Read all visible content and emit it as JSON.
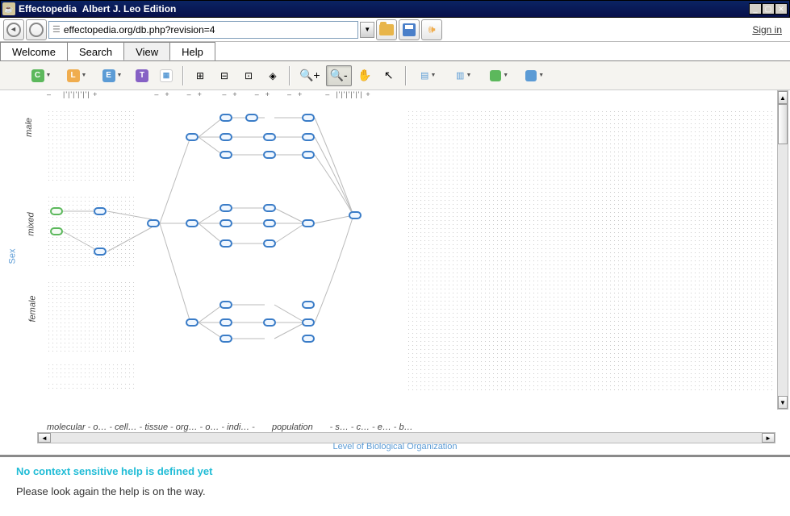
{
  "titlebar": {
    "app_name": "Effectopedia",
    "edition": "Albert J. Leo Edition"
  },
  "url": "effectopedia.org/db.php?revision=4",
  "signin_label": "Sign in",
  "tabs": [
    {
      "label": "Welcome",
      "key": "welcome"
    },
    {
      "label": "Search",
      "key": "search"
    },
    {
      "label": "View",
      "key": "view",
      "active": true
    },
    {
      "label": "Help",
      "key": "help"
    }
  ],
  "toolbar_icons": [
    {
      "name": "chemical-icon",
      "letter": "C",
      "color": "#5cb85c",
      "dd": true
    },
    {
      "name": "link-icon",
      "letter": "L",
      "color": "#f0ad4e",
      "dd": true
    },
    {
      "name": "effect-icon",
      "letter": "E",
      "color": "#5b9bd5",
      "dd": true
    },
    {
      "name": "test-icon",
      "letter": "T",
      "color": "#8661c5"
    },
    {
      "name": "grid-icon",
      "letter": "▦",
      "color": "#d9534f"
    }
  ],
  "axes": {
    "y_label": "Sex",
    "y_ticks": [
      "male",
      "mixed",
      "female"
    ],
    "x_label": "Level of Biological Organization",
    "x_ticks": [
      "molecular",
      "o…",
      "cell…",
      "tissue",
      "org…",
      "o…",
      "indi…",
      "population",
      "s…",
      "c…",
      "e…",
      "b…"
    ]
  },
  "help": {
    "title": "No context sensitive help is defined yet",
    "text": "Please look again the help is on the way."
  }
}
